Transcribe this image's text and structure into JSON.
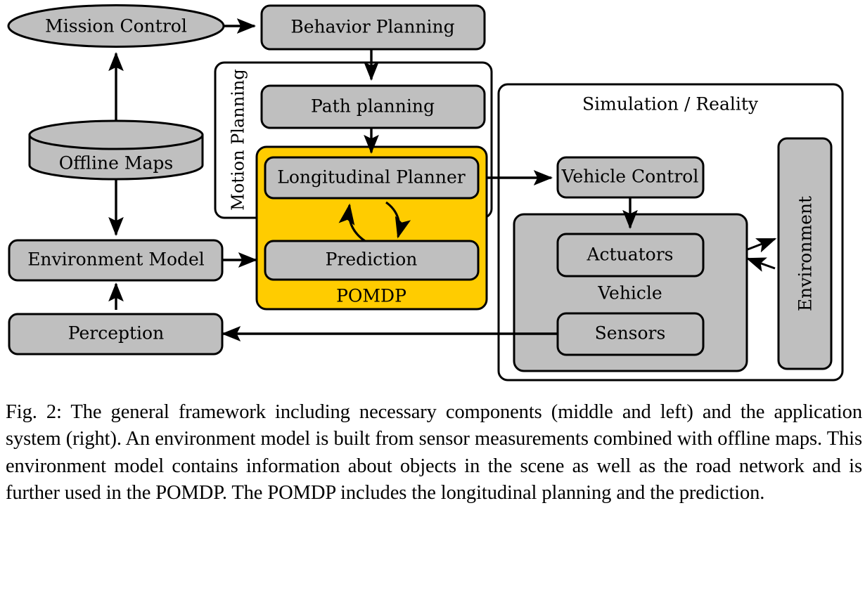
{
  "figure": {
    "caption": "Fig. 2: The general framework including necessary components (middle and left) and the application system (right). An environment model is built from sensor measurements combined with offline maps. This environment model contains information about objects in the scene as well as the road network and is further used in the POMDP. The POMDP includes the longitudinal planning and the prediction."
  },
  "colors": {
    "node_gray": "#BFBFBF",
    "pomdp_yellow": "#FFCC00",
    "stroke": "#000000",
    "background": "#FFFFFF"
  },
  "nodes": {
    "mission_control": "Mission Control",
    "behavior_planning": "Behavior Planning",
    "offline_maps": "Offline Maps",
    "path_planning": "Path planning",
    "longitudinal_planner": "Longitudinal Planner",
    "environment_model": "Environment Model",
    "prediction": "Prediction",
    "perception": "Perception",
    "vehicle_control": "Vehicle Control",
    "actuators": "Actuators",
    "sensors": "Sensors",
    "environment": "Environment"
  },
  "groups": {
    "motion_planning": "Motion Planning",
    "pomdp": "POMDP",
    "simulation_reality": "Simulation / Reality",
    "vehicle": "Vehicle"
  },
  "edges": [
    {
      "from": "mission_control",
      "to": "behavior_planning",
      "kind": "arrow"
    },
    {
      "from": "offline_maps",
      "to": "mission_control",
      "kind": "arrow"
    },
    {
      "from": "offline_maps",
      "to": "environment_model",
      "kind": "arrow"
    },
    {
      "from": "behavior_planning",
      "to": "path_planning",
      "kind": "arrow"
    },
    {
      "from": "path_planning",
      "to": "longitudinal_planner",
      "kind": "arrow"
    },
    {
      "from": "environment_model",
      "to": "prediction",
      "kind": "arrow"
    },
    {
      "from": "perception",
      "to": "environment_model",
      "kind": "arrow"
    },
    {
      "from": "prediction",
      "to": "longitudinal_planner",
      "kind": "curved-arrow"
    },
    {
      "from": "longitudinal_planner",
      "to": "prediction",
      "kind": "curved-arrow"
    },
    {
      "from": "longitudinal_planner",
      "to": "vehicle_control",
      "kind": "arrow"
    },
    {
      "from": "vehicle_control",
      "to": "actuators",
      "kind": "arrow"
    },
    {
      "from": "vehicle",
      "to": "environment",
      "kind": "arrow"
    },
    {
      "from": "environment",
      "to": "vehicle",
      "kind": "arrow"
    },
    {
      "from": "sensors",
      "to": "perception",
      "kind": "arrow"
    }
  ]
}
